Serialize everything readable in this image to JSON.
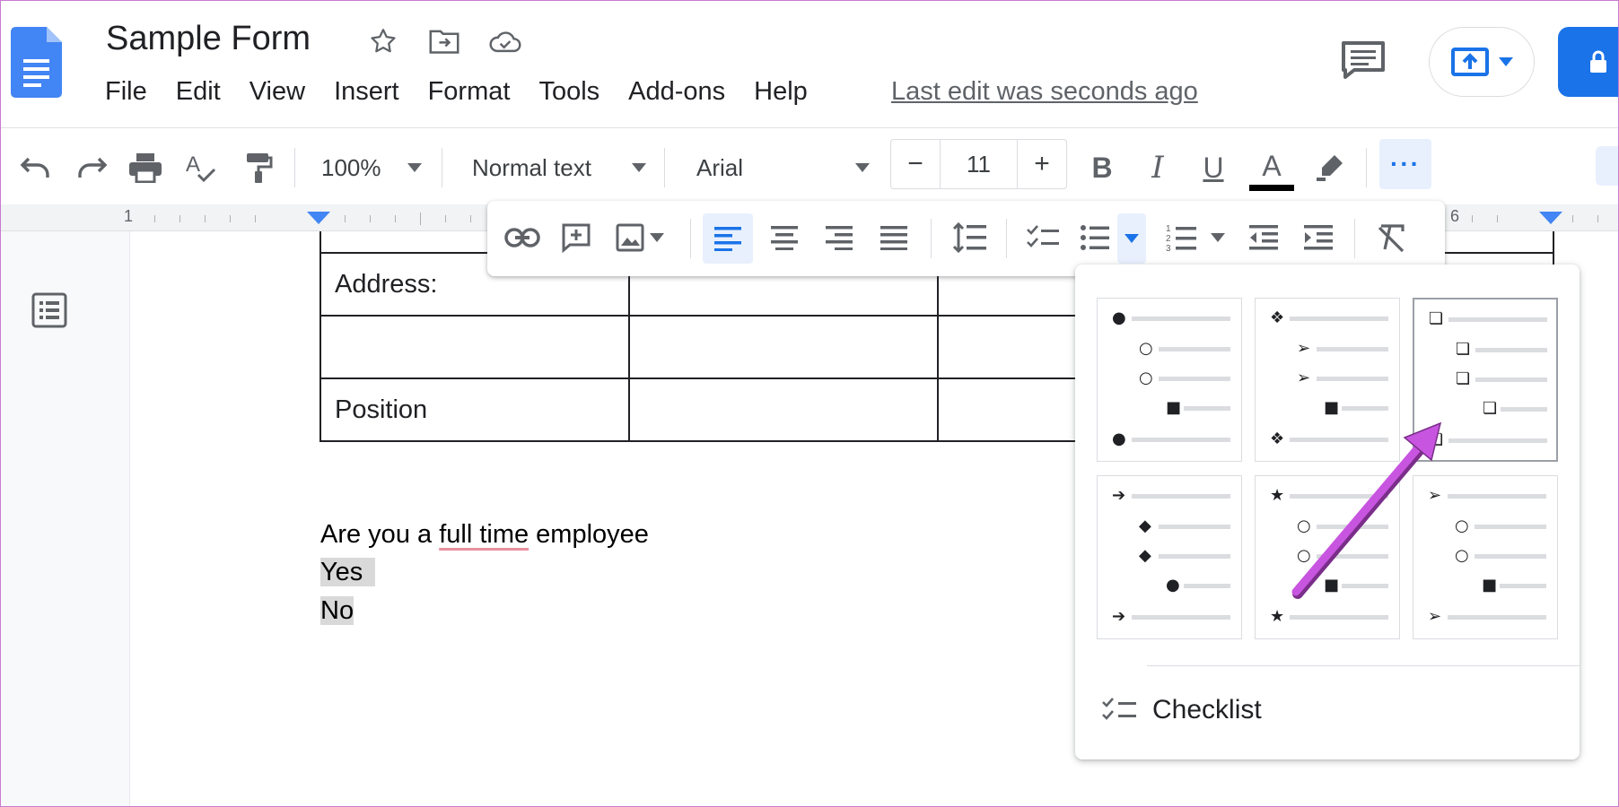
{
  "header": {
    "title": "Sample Form",
    "menu": [
      "File",
      "Edit",
      "View",
      "Insert",
      "Format",
      "Tools",
      "Add-ons",
      "Help"
    ],
    "last_edit": "Last edit was seconds ago"
  },
  "toolbar": {
    "zoom": "100%",
    "style": "Normal text",
    "font": "Arial",
    "font_size": "11",
    "minus": "−",
    "plus": "+",
    "bold": "B",
    "italic": "I",
    "underline": "U",
    "text_color": "A",
    "more": "···"
  },
  "ruler": {
    "left_num": "1",
    "right_num": "6"
  },
  "table": {
    "rows": [
      [
        "Address:",
        "",
        ""
      ],
      [
        "",
        "",
        ""
      ],
      [
        "Position",
        "",
        ""
      ]
    ]
  },
  "body": {
    "question_prefix": "Are you a ",
    "question_misspelled": "full time",
    "question_suffix": " employee",
    "option_yes": "Yes",
    "option_no": "No"
  },
  "bullet_menu": {
    "checklist_label": "Checklist",
    "presets": [
      {
        "name": "bullet-preset-disc-circle-square",
        "glyphs": [
          "●",
          "○",
          "○",
          "■",
          "●"
        ]
      },
      {
        "name": "bullet-preset-diamond-arrow",
        "glyphs": [
          "❖",
          "➢",
          "➢",
          "■",
          "❖"
        ]
      },
      {
        "name": "bullet-preset-3d-box",
        "glyphs": [
          "❏",
          "❏",
          "❏",
          "❏",
          "❏"
        ]
      },
      {
        "name": "bullet-preset-arrow-diamond-disc",
        "glyphs": [
          "➔",
          "◆",
          "◆",
          "●",
          "➔"
        ]
      },
      {
        "name": "bullet-preset-star-circle-square",
        "glyphs": [
          "★",
          "○",
          "○",
          "■",
          "★"
        ]
      },
      {
        "name": "bullet-preset-arrowhead-circle-square",
        "glyphs": [
          "➢",
          "○",
          "○",
          "■",
          "➢"
        ]
      }
    ]
  },
  "colors": {
    "accent": "#1a73e8",
    "arrow": "#c855e0",
    "highlight": "#d9d9d9"
  }
}
